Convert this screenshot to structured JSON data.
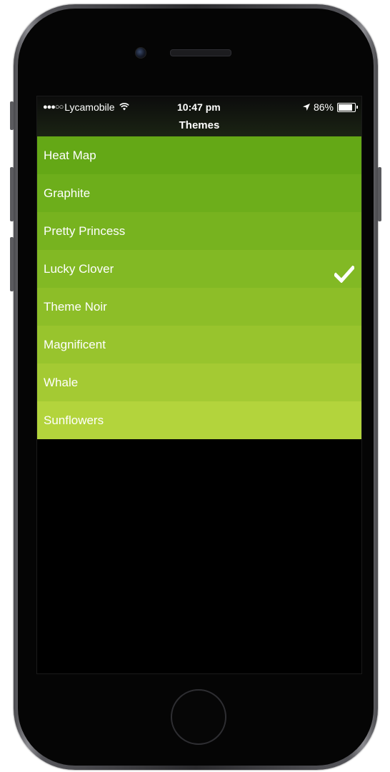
{
  "status_bar": {
    "signal": "●●●○○",
    "carrier": "Lycamobile",
    "wifi_icon": "wifi-icon",
    "time": "10:47 pm",
    "location_icon": "location-arrow-icon",
    "battery_text": "86%",
    "battery_level": 0.86
  },
  "nav": {
    "title": "Themes"
  },
  "themes": [
    {
      "label": "Heat Map",
      "color": "#64a816",
      "selected": false
    },
    {
      "label": "Graphite",
      "color": "#6dae1b",
      "selected": false
    },
    {
      "label": "Pretty Princess",
      "color": "#77b31f",
      "selected": false
    },
    {
      "label": "Lucky Clover",
      "color": "#82b924",
      "selected": true
    },
    {
      "label": "Theme Noir",
      "color": "#8dbe28",
      "selected": false
    },
    {
      "label": "Magnificent",
      "color": "#98c42d",
      "selected": false
    },
    {
      "label": "Whale",
      "color": "#a4ca33",
      "selected": false
    },
    {
      "label": "Sunflowers",
      "color": "#b3d43c",
      "selected": false
    }
  ],
  "selected_icon": "checkmark-icon"
}
